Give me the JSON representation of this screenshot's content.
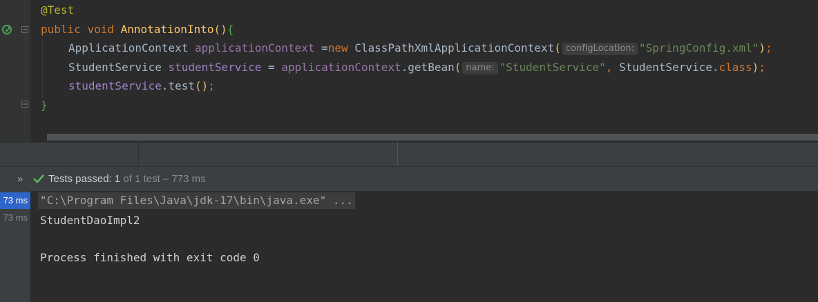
{
  "editor": {
    "annotation": "@Test",
    "method_decl": {
      "kw_public": "public",
      "kw_void": "void",
      "method_name": "AnnotationInto",
      "parens": "()",
      "open_brace": "{"
    },
    "line3": {
      "type": "ApplicationContext",
      "var": "applicationContext",
      "assign": " =",
      "kw_new": "new",
      "class": " ClassPathXmlApplicationContext",
      "open_paren": "(",
      "hint": "configLocation:",
      "arg": "\"SpringConfig.xml\"",
      "close_paren": ")",
      "semi": ";"
    },
    "line4": {
      "type": "StudentService",
      "var": "studentService",
      "assign": " = ",
      "receiver": "applicationContext",
      "call": ".getBean",
      "open_paren": "(",
      "hint": "name:",
      "arg1": "\"StudentService\"",
      "comma": ", ",
      "arg2_class": "StudentService.",
      "arg2_kw": "class",
      "close_paren": ")",
      "semi": ";"
    },
    "line5": {
      "var": "studentService",
      "call": ".test",
      "parens": "()",
      "semi": ";"
    },
    "close_brace": "}"
  },
  "test_status": {
    "label": "Tests passed: ",
    "count": "1",
    "rest": " of 1 test – 773 ms"
  },
  "test_tree": {
    "rows": [
      "73 ms",
      "73 ms"
    ]
  },
  "console": {
    "command": "\"C:\\Program Files\\Java\\jdk-17\\bin\\java.exe\" ...",
    "output": "StudentDaoImpl2",
    "exit": "Process finished with exit code 0"
  },
  "icons": {
    "run": "run-test-icon",
    "fold": "fold-icon",
    "expand": "expand-icon",
    "check": "check-icon"
  },
  "colors": {
    "editor_bg": "#2b2b2b",
    "panel_bg": "#3c3f41",
    "selection": "#2f65ca",
    "pass_green": "#5fb85f"
  }
}
